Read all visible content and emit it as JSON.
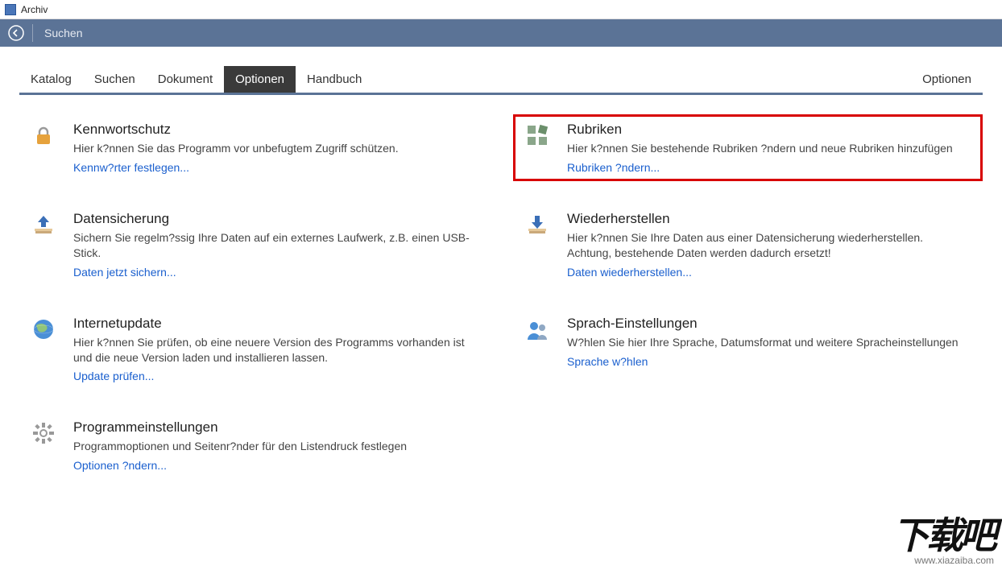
{
  "window": {
    "title": "Archiv"
  },
  "toolbar": {
    "search": "Suchen"
  },
  "tabs": {
    "items": [
      "Katalog",
      "Suchen",
      "Dokument",
      "Optionen",
      "Handbuch"
    ],
    "active_index": 3,
    "right": "Optionen"
  },
  "cards": [
    {
      "id": "password",
      "icon": "lock-icon",
      "title": "Kennwortschutz",
      "desc": "Hier k?nnen Sie das Programm vor unbefugtem Zugriff schützen.",
      "link": "Kennw?rter festlegen...",
      "highlight": false
    },
    {
      "id": "rubrics",
      "icon": "grid-icon",
      "title": "Rubriken",
      "desc": "Hier k?nnen Sie bestehende Rubriken ?ndern und neue Rubriken hinzufügen",
      "link": "Rubriken ?ndern...",
      "highlight": true
    },
    {
      "id": "backup",
      "icon": "upload-icon",
      "title": "Datensicherung",
      "desc": "Sichern Sie regelm?ssig Ihre Daten auf ein externes Laufwerk, z.B. einen USB-Stick.",
      "link": "Daten jetzt sichern...",
      "highlight": false
    },
    {
      "id": "restore",
      "icon": "download-icon",
      "title": "Wiederherstellen",
      "desc": "Hier k?nnen Sie Ihre Daten aus einer Datensicherung wiederherstellen. Achtung, bestehende Daten werden dadurch ersetzt!",
      "link": "Daten wiederherstellen...",
      "highlight": false
    },
    {
      "id": "update",
      "icon": "globe-icon",
      "title": "Internetupdate",
      "desc": "Hier k?nnen Sie prüfen, ob eine neuere Version des Programms vorhanden ist und die neue Version laden und installieren lassen.",
      "link": "Update prüfen...",
      "highlight": false
    },
    {
      "id": "language",
      "icon": "person-icon",
      "title": "Sprach-Einstellungen",
      "desc": "W?hlen Sie hier Ihre Sprache, Datumsformat und weitere Spracheinstellungen",
      "link": "Sprache w?hlen",
      "highlight": false
    },
    {
      "id": "settings",
      "icon": "gear-icon",
      "title": "Programmeinstellungen",
      "desc": "Programmoptionen und Seitenr?nder für den Listendruck festlegen",
      "link": "Optionen ?ndern...",
      "highlight": false
    }
  ],
  "watermark": {
    "text": "下载吧",
    "url": "www.xiazaiba.com"
  }
}
